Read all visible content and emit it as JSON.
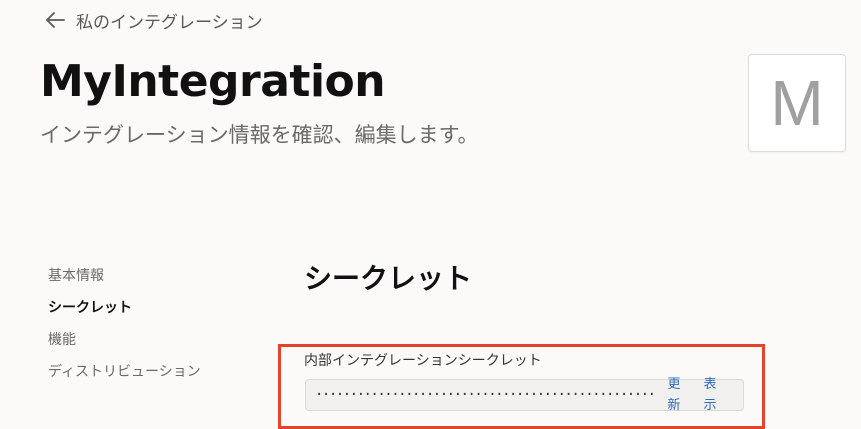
{
  "header": {
    "back_label": "私のインテグレーション",
    "title": "MyIntegration",
    "subtitle": "インテグレーション情報を確認、編集します。",
    "avatar_letter": "M"
  },
  "sidebar": {
    "items": [
      {
        "label": "基本情報",
        "active": false
      },
      {
        "label": "シークレット",
        "active": true
      },
      {
        "label": "機能",
        "active": false
      },
      {
        "label": "ディストリビューション",
        "active": false
      }
    ]
  },
  "main": {
    "section_title": "シークレット",
    "secret": {
      "label": "内部インテグレーションシークレット",
      "value": "································································",
      "refresh_label": "更新",
      "show_label": "表示"
    }
  },
  "colors": {
    "highlight": "#e2452b",
    "link": "#2f6cc1"
  }
}
